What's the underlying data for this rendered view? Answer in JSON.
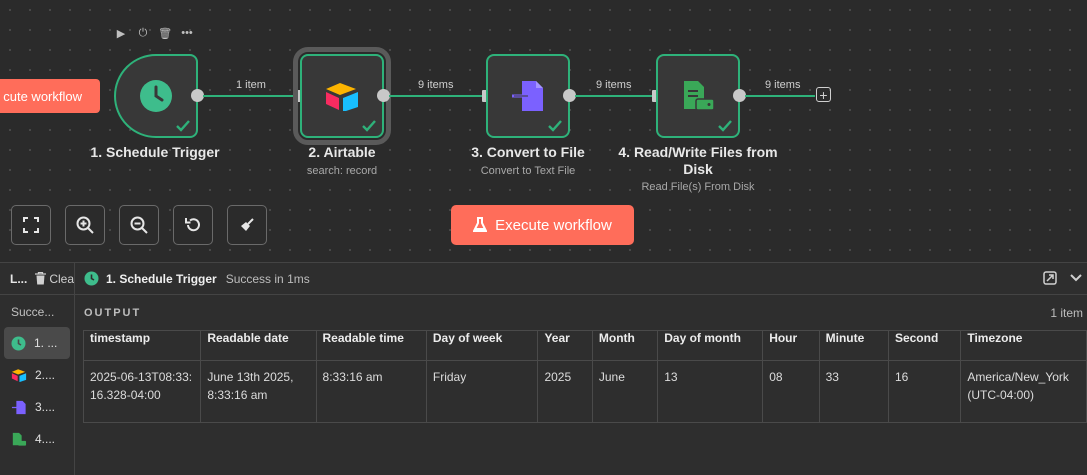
{
  "canvas": {
    "edge_execute_label": "cute workflow",
    "execute_label": "Execute workflow"
  },
  "nodes": [
    {
      "title": "1. Schedule Trigger",
      "subtitle": ""
    },
    {
      "title": "2. Airtable",
      "subtitle": "search: record"
    },
    {
      "title": "3. Convert to File",
      "subtitle": "Convert to Text File"
    },
    {
      "title": "4. Read/Write Files from Disk",
      "subtitle": "Read File(s) From Disk"
    }
  ],
  "edges": [
    "1 item",
    "9 items",
    "9 items",
    "9 items"
  ],
  "colors": {
    "accent": "#ff6d5a",
    "success": "#2eb27a",
    "canvas": "#2b2b2b"
  },
  "logs": {
    "title": "L...",
    "clear_label": "Clea",
    "status": "Succe...",
    "items": [
      {
        "label": "1. ...",
        "icon": "clock-icon"
      },
      {
        "label": "2....",
        "icon": "airtable-icon"
      },
      {
        "label": "3....",
        "icon": "convert-file-icon"
      },
      {
        "label": "4....",
        "icon": "disk-file-icon"
      }
    ]
  },
  "details": {
    "title": "1. Schedule Trigger",
    "status": "Success in 1ms",
    "output_label": "OUTPUT",
    "item_count": "1 item",
    "columns": [
      "timestamp",
      "Readable date",
      "Readable time",
      "Day of week",
      "Year",
      "Month",
      "Day of month",
      "Hour",
      "Minute",
      "Second",
      "Timezone"
    ],
    "rows": [
      [
        "2025-06-13T08:33:16.328-04:00",
        "June 13th 2025, 8:33:16 am",
        "8:33:16 am",
        "Friday",
        "2025",
        "June",
        "13",
        "08",
        "33",
        "16",
        "America/New_York (UTC-04:00)"
      ]
    ]
  }
}
